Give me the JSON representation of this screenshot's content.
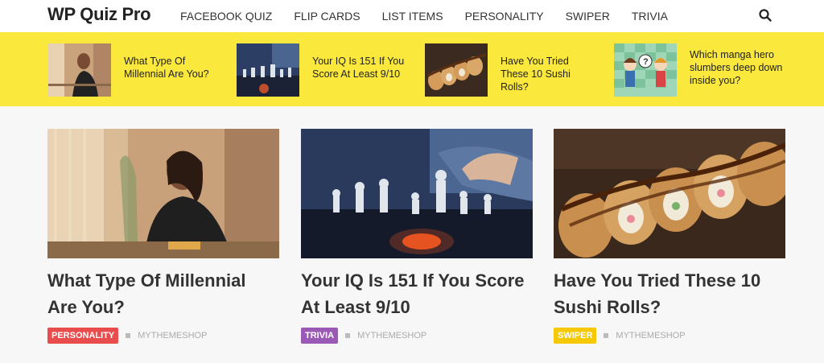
{
  "site": {
    "logo": "WP Quiz Pro"
  },
  "nav": {
    "items": [
      "FACEBOOK QUIZ",
      "FLIP CARDS",
      "LIST ITEMS",
      "PERSONALITY",
      "SWIPER",
      "TRIVIA"
    ]
  },
  "icons": {
    "search": "search-icon"
  },
  "strip": {
    "items": [
      {
        "title": "What Type Of Millennial Are You?",
        "thumb": "woman-photo"
      },
      {
        "title": "Your IQ Is 151 If You Score At Least 9/10",
        "thumb": "chess-photo"
      },
      {
        "title": "Have You Tried These 10 Sushi Rolls?",
        "thumb": "sushi-photo"
      },
      {
        "title": "Which manga hero slumbers deep down inside you?",
        "thumb": "manga-illustration"
      }
    ]
  },
  "cards": [
    {
      "title": "What Type Of Millennial Are You?",
      "badge": "PERSONALITY",
      "badge_color": "#e84c4c",
      "author": "MYTHEMESHOP"
    },
    {
      "title": "Your IQ Is 151 If You Score At Least 9/10",
      "badge": "TRIVIA",
      "badge_color": "#9b59b6",
      "author": "MYTHEMESHOP"
    },
    {
      "title": "Have You Tried These 10 Sushi Rolls?",
      "badge": "SWIPER",
      "badge_color": "#f5c800",
      "author": "MYTHEMESHOP"
    }
  ],
  "colors": {
    "strip_bg": "#fbe83c",
    "page_bg": "#f7f7f7"
  }
}
